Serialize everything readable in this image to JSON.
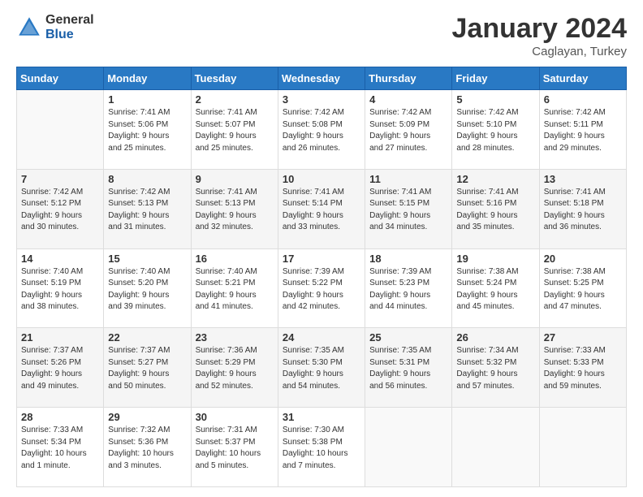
{
  "logo": {
    "general": "General",
    "blue": "Blue"
  },
  "header": {
    "month": "January 2024",
    "location": "Caglayan, Turkey"
  },
  "weekdays": [
    "Sunday",
    "Monday",
    "Tuesday",
    "Wednesday",
    "Thursday",
    "Friday",
    "Saturday"
  ],
  "weeks": [
    [
      {
        "day": "",
        "info": ""
      },
      {
        "day": "1",
        "info": "Sunrise: 7:41 AM\nSunset: 5:06 PM\nDaylight: 9 hours\nand 25 minutes."
      },
      {
        "day": "2",
        "info": "Sunrise: 7:41 AM\nSunset: 5:07 PM\nDaylight: 9 hours\nand 25 minutes."
      },
      {
        "day": "3",
        "info": "Sunrise: 7:42 AM\nSunset: 5:08 PM\nDaylight: 9 hours\nand 26 minutes."
      },
      {
        "day": "4",
        "info": "Sunrise: 7:42 AM\nSunset: 5:09 PM\nDaylight: 9 hours\nand 27 minutes."
      },
      {
        "day": "5",
        "info": "Sunrise: 7:42 AM\nSunset: 5:10 PM\nDaylight: 9 hours\nand 28 minutes."
      },
      {
        "day": "6",
        "info": "Sunrise: 7:42 AM\nSunset: 5:11 PM\nDaylight: 9 hours\nand 29 minutes."
      }
    ],
    [
      {
        "day": "7",
        "info": "Sunrise: 7:42 AM\nSunset: 5:12 PM\nDaylight: 9 hours\nand 30 minutes."
      },
      {
        "day": "8",
        "info": "Sunrise: 7:42 AM\nSunset: 5:13 PM\nDaylight: 9 hours\nand 31 minutes."
      },
      {
        "day": "9",
        "info": "Sunrise: 7:41 AM\nSunset: 5:13 PM\nDaylight: 9 hours\nand 32 minutes."
      },
      {
        "day": "10",
        "info": "Sunrise: 7:41 AM\nSunset: 5:14 PM\nDaylight: 9 hours\nand 33 minutes."
      },
      {
        "day": "11",
        "info": "Sunrise: 7:41 AM\nSunset: 5:15 PM\nDaylight: 9 hours\nand 34 minutes."
      },
      {
        "day": "12",
        "info": "Sunrise: 7:41 AM\nSunset: 5:16 PM\nDaylight: 9 hours\nand 35 minutes."
      },
      {
        "day": "13",
        "info": "Sunrise: 7:41 AM\nSunset: 5:18 PM\nDaylight: 9 hours\nand 36 minutes."
      }
    ],
    [
      {
        "day": "14",
        "info": "Sunrise: 7:40 AM\nSunset: 5:19 PM\nDaylight: 9 hours\nand 38 minutes."
      },
      {
        "day": "15",
        "info": "Sunrise: 7:40 AM\nSunset: 5:20 PM\nDaylight: 9 hours\nand 39 minutes."
      },
      {
        "day": "16",
        "info": "Sunrise: 7:40 AM\nSunset: 5:21 PM\nDaylight: 9 hours\nand 41 minutes."
      },
      {
        "day": "17",
        "info": "Sunrise: 7:39 AM\nSunset: 5:22 PM\nDaylight: 9 hours\nand 42 minutes."
      },
      {
        "day": "18",
        "info": "Sunrise: 7:39 AM\nSunset: 5:23 PM\nDaylight: 9 hours\nand 44 minutes."
      },
      {
        "day": "19",
        "info": "Sunrise: 7:38 AM\nSunset: 5:24 PM\nDaylight: 9 hours\nand 45 minutes."
      },
      {
        "day": "20",
        "info": "Sunrise: 7:38 AM\nSunset: 5:25 PM\nDaylight: 9 hours\nand 47 minutes."
      }
    ],
    [
      {
        "day": "21",
        "info": "Sunrise: 7:37 AM\nSunset: 5:26 PM\nDaylight: 9 hours\nand 49 minutes."
      },
      {
        "day": "22",
        "info": "Sunrise: 7:37 AM\nSunset: 5:27 PM\nDaylight: 9 hours\nand 50 minutes."
      },
      {
        "day": "23",
        "info": "Sunrise: 7:36 AM\nSunset: 5:29 PM\nDaylight: 9 hours\nand 52 minutes."
      },
      {
        "day": "24",
        "info": "Sunrise: 7:35 AM\nSunset: 5:30 PM\nDaylight: 9 hours\nand 54 minutes."
      },
      {
        "day": "25",
        "info": "Sunrise: 7:35 AM\nSunset: 5:31 PM\nDaylight: 9 hours\nand 56 minutes."
      },
      {
        "day": "26",
        "info": "Sunrise: 7:34 AM\nSunset: 5:32 PM\nDaylight: 9 hours\nand 57 minutes."
      },
      {
        "day": "27",
        "info": "Sunrise: 7:33 AM\nSunset: 5:33 PM\nDaylight: 9 hours\nand 59 minutes."
      }
    ],
    [
      {
        "day": "28",
        "info": "Sunrise: 7:33 AM\nSunset: 5:34 PM\nDaylight: 10 hours\nand 1 minute."
      },
      {
        "day": "29",
        "info": "Sunrise: 7:32 AM\nSunset: 5:36 PM\nDaylight: 10 hours\nand 3 minutes."
      },
      {
        "day": "30",
        "info": "Sunrise: 7:31 AM\nSunset: 5:37 PM\nDaylight: 10 hours\nand 5 minutes."
      },
      {
        "day": "31",
        "info": "Sunrise: 7:30 AM\nSunset: 5:38 PM\nDaylight: 10 hours\nand 7 minutes."
      },
      {
        "day": "",
        "info": ""
      },
      {
        "day": "",
        "info": ""
      },
      {
        "day": "",
        "info": ""
      }
    ]
  ]
}
